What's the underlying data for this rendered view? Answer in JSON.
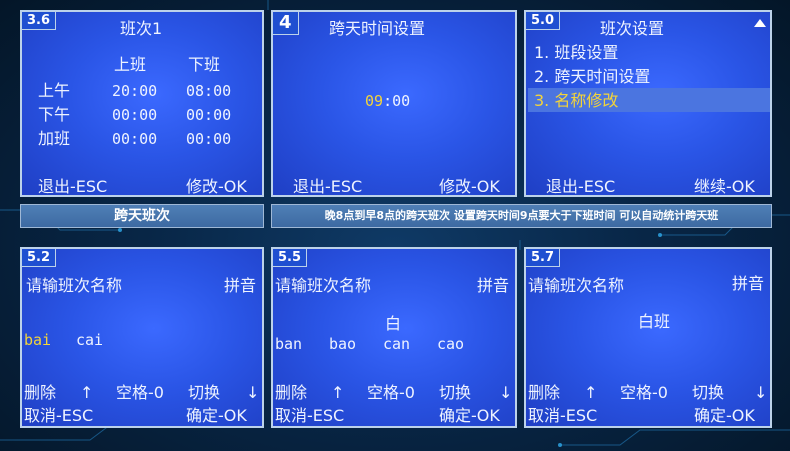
{
  "screens": {
    "s1": {
      "tag": "3.6",
      "title": "班次1",
      "col_on": "上班",
      "col_off": "下班",
      "rows": [
        {
          "label": "上午",
          "on": "20:00",
          "off": "08:00"
        },
        {
          "label": "下午",
          "on": "00:00",
          "off": "00:00"
        },
        {
          "label": "加班",
          "on": "00:00",
          "off": "00:00"
        }
      ],
      "exit": "退出-ESC",
      "modify": "修改-OK"
    },
    "s2": {
      "tag": "4",
      "title": "跨天时间设置",
      "time_hour": "09",
      "time_rest": ":00",
      "exit": "退出-ESC",
      "modify": "修改-OK"
    },
    "s3": {
      "tag": "5.0",
      "title": "班次设置",
      "menu": [
        "1. 班段设置",
        "2. 跨天时间设置",
        "3. 名称修改"
      ],
      "exit": "退出-ESC",
      "continue": "继续-OK"
    },
    "s4": {
      "tag": "5.2",
      "prompt": "请输班次名称",
      "mode": "拼音",
      "candidates": [
        "bai",
        "cai"
      ],
      "delete": "删除",
      "up": "↑",
      "space": "空格-0",
      "switch": "切换",
      "down": "↓",
      "cancel": "取消-ESC",
      "confirm": "确定-OK"
    },
    "s5": {
      "tag": "5.5",
      "prompt": "请输班次名称",
      "mode": "拼音",
      "input": "白",
      "candidates": [
        "ban",
        "bao",
        "can",
        "cao"
      ],
      "delete": "删除",
      "up": "↑",
      "space": "空格-0",
      "switch": "切换",
      "down": "↓",
      "cancel": "取消-ESC",
      "confirm": "确定-OK"
    },
    "s6": {
      "tag": "5.7",
      "prompt": "请输班次名称",
      "mode": "拼音",
      "input": "白班",
      "delete": "删除",
      "up": "↑",
      "space": "空格-0",
      "switch": "切换",
      "down": "↓",
      "cancel": "取消-ESC",
      "confirm": "确定-OK"
    }
  },
  "banners": {
    "left": "跨天班次",
    "right": "晚8点到早8点的跨天班次 设置跨天时间9点要大于下班时间 可以自动统计跨天班"
  },
  "colors": {
    "screen_blue": "#2a55e6",
    "highlight_text": "#f3d43a",
    "banner_blue": "#4475ad"
  }
}
